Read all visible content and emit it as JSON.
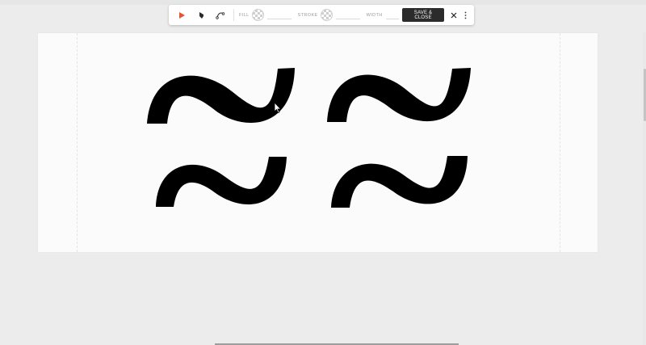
{
  "toolbar": {
    "tools": [
      {
        "name": "select-tool",
        "icon": "arrow-pointer-icon",
        "active": true
      },
      {
        "name": "shape-tool",
        "icon": "shape-icon",
        "active": false
      },
      {
        "name": "line-tool",
        "icon": "line-path-icon",
        "active": false
      }
    ],
    "fill_label": "FILL",
    "stroke_label": "STROKE",
    "width_label": "WIDTH",
    "save_label": "SAVE & CLOSE",
    "close_icon": "close-icon",
    "more_icon": "more-vertical-icon"
  },
  "colors": {
    "accent": "#e8542c",
    "button": "#2b2b2b",
    "shape_fill": "#000000"
  },
  "canvas": {
    "shapes": [
      "tilde",
      "tilde",
      "tilde",
      "tilde"
    ]
  }
}
